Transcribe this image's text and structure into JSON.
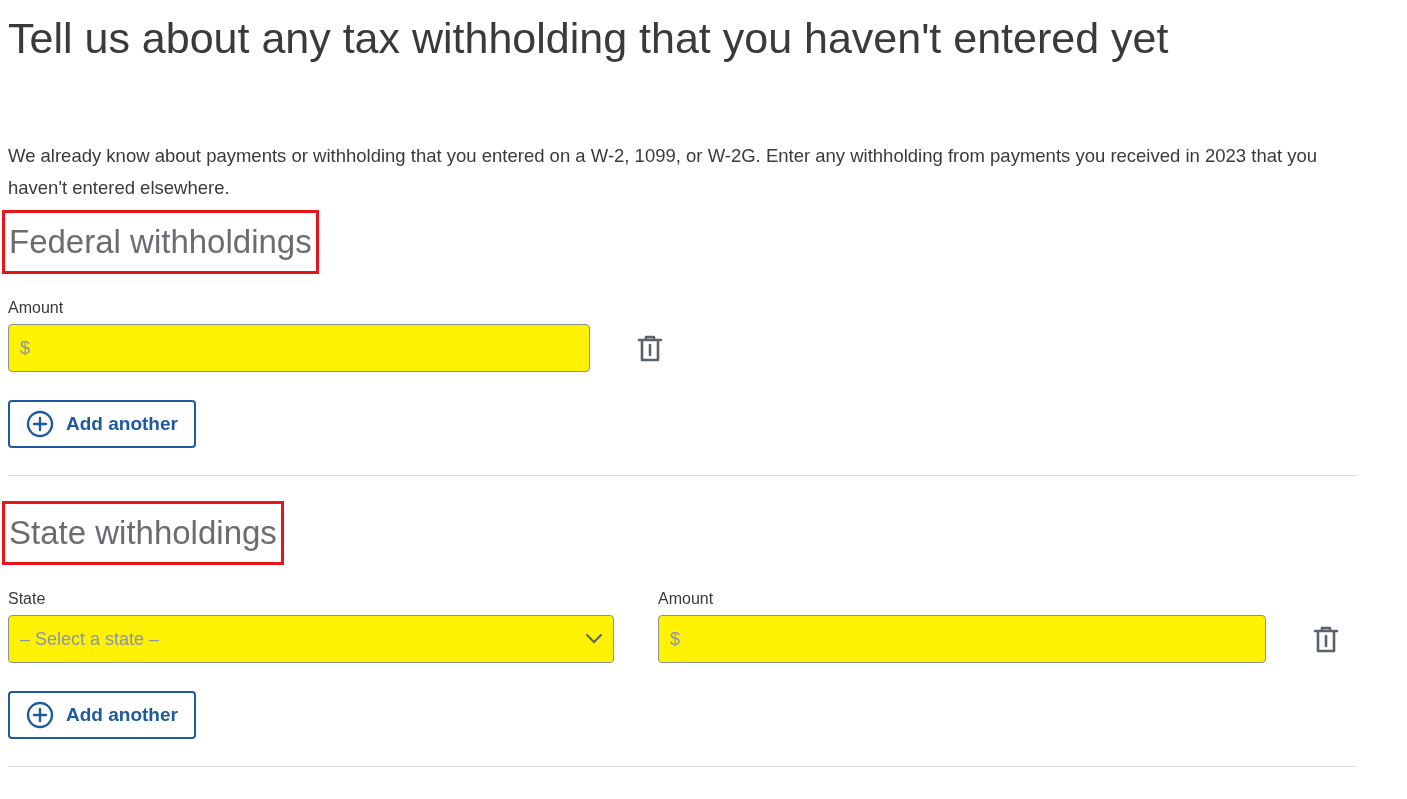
{
  "title": "Tell us about any tax withholding that you haven't entered yet",
  "intro": "We already know about payments or withholding that you entered on a W-2, 1099, or W-2G. Enter any withholding from payments you received in 2023 that you haven't entered elsewhere.",
  "sections": [
    {
      "heading": "Federal withholdings",
      "highlighted": true,
      "fields": [
        {
          "kind": "amount",
          "label": "Amount",
          "placeholder": "$"
        }
      ],
      "add_button": "Add another"
    },
    {
      "heading": "State withholdings",
      "highlighted": true,
      "fields": [
        {
          "kind": "select",
          "label": "State",
          "placeholder": "– Select a state –"
        },
        {
          "kind": "amount",
          "label": "Amount",
          "placeholder": "$"
        }
      ],
      "add_button": "Add another"
    }
  ]
}
